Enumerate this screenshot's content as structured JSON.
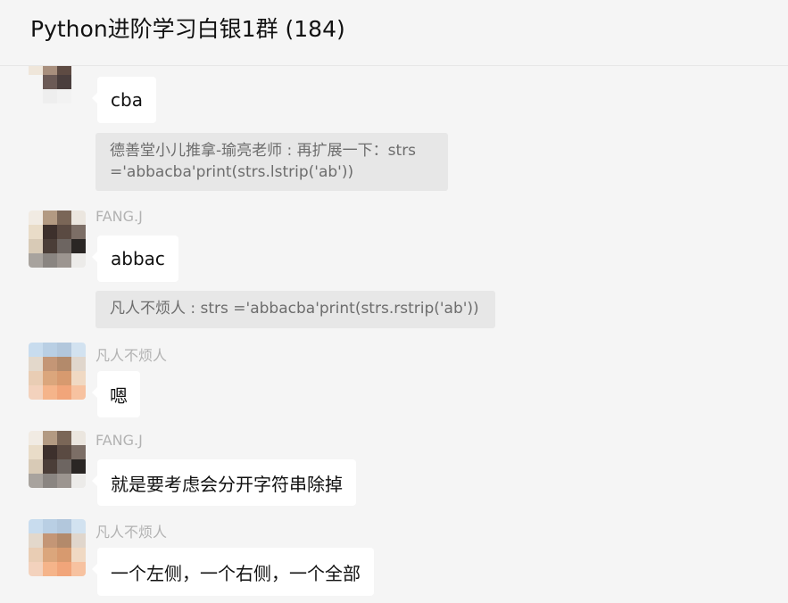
{
  "header": {
    "title": "Python进阶学习白银1群 (184)"
  },
  "messages": [
    {
      "sender": "",
      "text": "cba",
      "quote": "德善堂小儿推拿-瑜亮老师 : 再扩展一下：strs ='abbacba'print(strs.lstrip('ab'))"
    },
    {
      "sender": "FANG.J",
      "text": "abbac",
      "quote": "凡人不烦人 : strs ='abbacba'print(strs.rstrip('ab'))"
    },
    {
      "sender": "凡人不烦人",
      "text": "嗯"
    },
    {
      "sender": "FANG.J",
      "text": "就是要考虑会分开字符串除掉"
    },
    {
      "sender": "凡人不烦人",
      "text": "一个左侧，一个右侧，一个全部"
    }
  ]
}
